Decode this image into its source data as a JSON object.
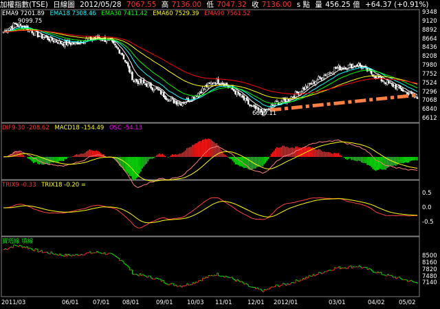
{
  "header": {
    "name": "加權指數(TSE)",
    "chart_kind": "日線圖",
    "date": "2012/05/28",
    "open_value": "7067.55",
    "high_label": "高",
    "high_value": "7136.00",
    "low_label": "低",
    "low_value": "7047.32",
    "close_label": "收",
    "close_value": "7136.00",
    "tick": "s 點",
    "volume_label": "量",
    "volume_value": "456.25 億",
    "change": "+64.37 (+0.91%)"
  },
  "price_panel": {
    "ema9": "EMA9 7201.89",
    "ema18": "EMA18 7308.46",
    "ema30": "EMA30 7411.42",
    "ema60": "EMA60 7529.39",
    "ema90": "EMA90 7561.52",
    "high_annotation": "9099.75",
    "low_annotation": "6609.11",
    "y_ticks": [
      "9348",
      "9120",
      "8892",
      "8664",
      "8436",
      "8208",
      "7980",
      "7752",
      "7524",
      "7296",
      "7068",
      "6840",
      "6612"
    ]
  },
  "macd_panel": {
    "dif": "DIF9-30 -208.62",
    "macd": "MACD18 -154.49",
    "osc": "OSC -54.13"
  },
  "trix_panel": {
    "trix9": "TRIX9 -0.33",
    "trix18": "TRIX18 -0.20 =",
    "y_ticks": [
      "0.5",
      "0.0",
      "-0.5"
    ]
  },
  "line_panel": {
    "title": "寶塔線 填線",
    "y_ticks": [
      "8500",
      "8160",
      "7820",
      "7480",
      "7140"
    ]
  },
  "x_axis": [
    "2011/03",
    "06/01",
    "07/01",
    "08/01",
    "09/01",
    "10/03",
    "11/01",
    "12/01",
    "2012/01",
    "03/01",
    "04/02",
    "05/02"
  ],
  "colors": {
    "up": "#ff2020",
    "down": "#00e000",
    "ema9": "#ffffff",
    "ema18": "#00ffff",
    "ema30": "#00ff00",
    "ema60": "#ffff00",
    "ema90": "#ff0000",
    "trend": "#ff8040",
    "osc": "#ff00ff"
  },
  "chart_data": [
    {
      "type": "candlestick",
      "title": "加權指數(TSE) 日線圖",
      "ylim": [
        6612,
        9348
      ],
      "x": [
        "2011/03",
        "06/01",
        "07/01",
        "08/01",
        "09/01",
        "10/03",
        "11/01",
        "12/01",
        "2012/01",
        "03/01",
        "04/02",
        "05/02"
      ],
      "close": [
        8850,
        9050,
        8950,
        8750,
        8650,
        8550,
        8550,
        8650,
        8700,
        8600,
        8300,
        7600,
        7500,
        7350,
        7100,
        7000,
        7150,
        7400,
        7600,
        7450,
        7200,
        6900,
        6750,
        7000,
        7100,
        7300,
        7500,
        7700,
        7900,
        7950,
        8000,
        7800,
        7600,
        7450,
        7300,
        7136
      ],
      "high_marker": 9099.75,
      "low_marker": 6609.11
    },
    {
      "type": "line",
      "title": "MACD",
      "series": [
        {
          "name": "DIF9-30",
          "last": -208.62
        },
        {
          "name": "MACD18",
          "last": -154.49
        },
        {
          "name": "OSC",
          "last": -54.13
        }
      ]
    },
    {
      "type": "line",
      "title": "TRIX",
      "ylim": [
        -0.5,
        0.5
      ],
      "series": [
        {
          "name": "TRIX9",
          "last": -0.33
        },
        {
          "name": "TRIX18",
          "last": -0.2
        }
      ]
    },
    {
      "type": "line",
      "title": "寶塔線 填線",
      "ylim": [
        7140,
        8500
      ]
    }
  ]
}
